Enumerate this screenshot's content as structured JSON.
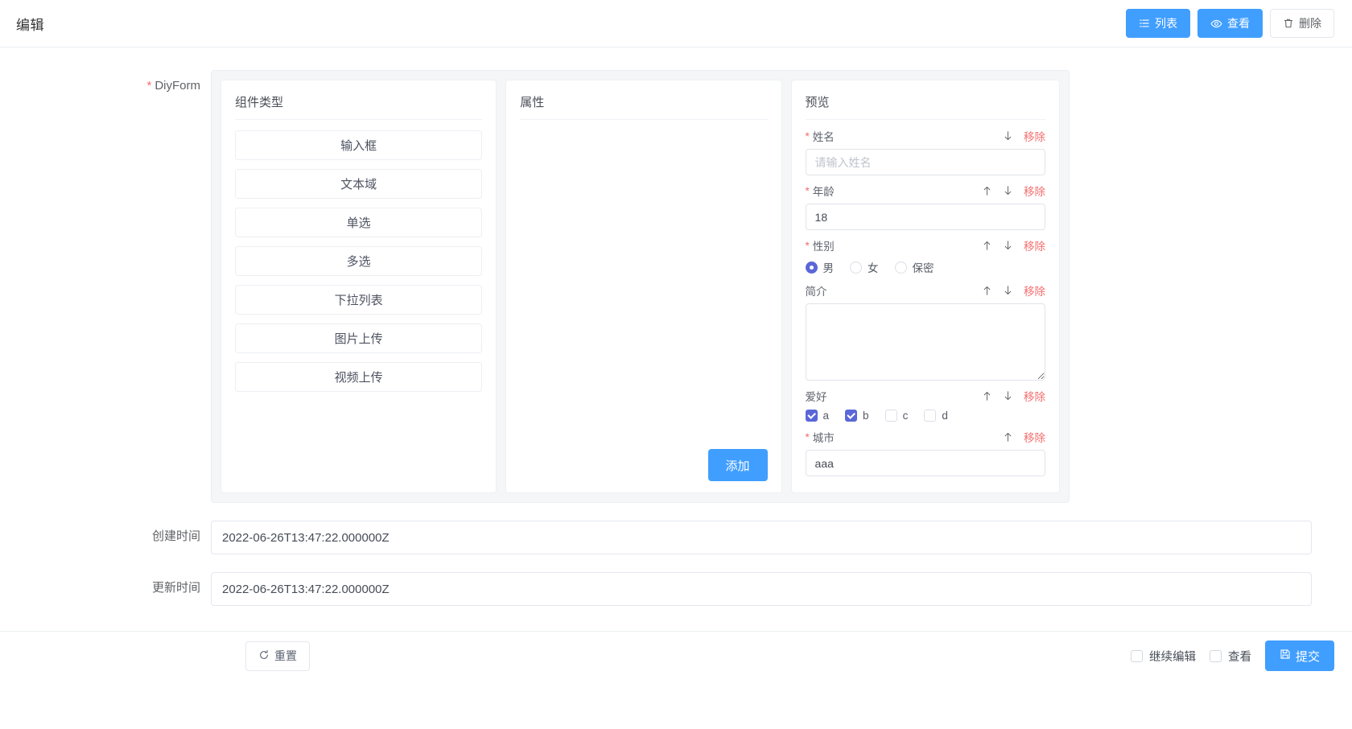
{
  "header": {
    "title": "编辑",
    "actions": [
      {
        "label": "列表",
        "icon": "list-icon",
        "style": "primary"
      },
      {
        "label": "查看",
        "icon": "eye-icon",
        "style": "primary"
      },
      {
        "label": "删除",
        "icon": "trash-icon",
        "style": "default"
      }
    ]
  },
  "form": {
    "diyform_label": "DiyForm",
    "diyform_required": true,
    "created_label": "创建时间",
    "created_value": "2022-06-26T13:47:22.000000Z",
    "updated_label": "更新时间",
    "updated_value": "2022-06-26T13:47:22.000000Z"
  },
  "builder": {
    "component_panel": {
      "title": "组件类型",
      "items": [
        {
          "label": "输入框"
        },
        {
          "label": "文本域"
        },
        {
          "label": "单选"
        },
        {
          "label": "多选"
        },
        {
          "label": "下拉列表"
        },
        {
          "label": "图片上传"
        },
        {
          "label": "视频上传"
        }
      ]
    },
    "property_panel": {
      "title": "属性",
      "add_label": "添加"
    },
    "preview_panel": {
      "title": "预览",
      "remove_label": "移除",
      "fields": [
        {
          "label": "姓名",
          "required": true,
          "type": "input",
          "value": "",
          "placeholder": "请输入姓名",
          "can_up": false,
          "can_down": true
        },
        {
          "label": "年龄",
          "required": true,
          "type": "input",
          "value": "18",
          "placeholder": "",
          "can_up": true,
          "can_down": true
        },
        {
          "label": "性别",
          "required": true,
          "type": "radio",
          "can_up": true,
          "can_down": true,
          "options": [
            {
              "label": "男",
              "checked": true
            },
            {
              "label": "女",
              "checked": false
            },
            {
              "label": "保密",
              "checked": false
            }
          ]
        },
        {
          "label": "简介",
          "required": false,
          "type": "textarea",
          "value": "",
          "can_up": true,
          "can_down": true
        },
        {
          "label": "爱好",
          "required": false,
          "type": "checkbox",
          "can_up": true,
          "can_down": true,
          "options": [
            {
              "label": "a",
              "checked": true
            },
            {
              "label": "b",
              "checked": true
            },
            {
              "label": "c",
              "checked": false
            },
            {
              "label": "d",
              "checked": false
            }
          ]
        },
        {
          "label": "城市",
          "required": true,
          "type": "input",
          "value": "aaa",
          "placeholder": "",
          "can_up": true,
          "can_down": false
        }
      ]
    }
  },
  "footer": {
    "reset_label": "重置",
    "continue_edit_label": "继续编辑",
    "continue_edit_checked": false,
    "view_label": "查看",
    "view_checked": false,
    "submit_label": "提交"
  },
  "colors": {
    "primary": "#409eff",
    "danger": "#f56c6c",
    "control_accent": "#5a67d8",
    "page_bg": "#f0f2f5",
    "panel_bg": "#f5f6f8"
  }
}
